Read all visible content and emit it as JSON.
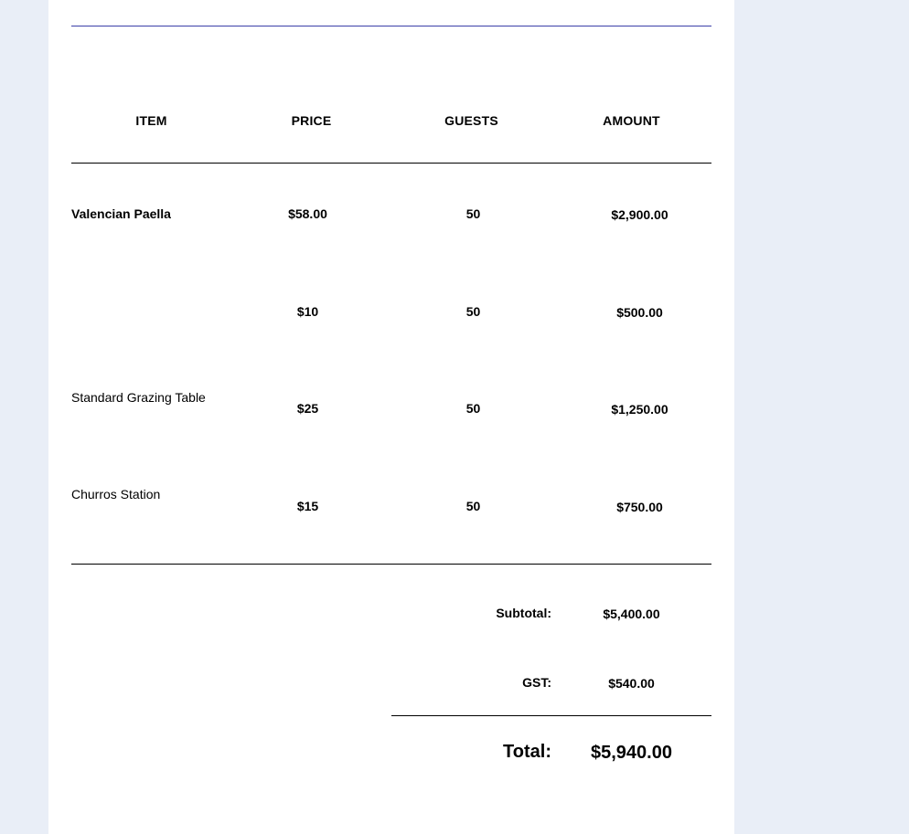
{
  "table": {
    "headers": {
      "item": "ITEM",
      "price": "PRICE",
      "guests": "GUESTS",
      "amount": "AMOUNT"
    },
    "rows": [
      {
        "item": "Valencian Paella",
        "price": "$58.00",
        "guests": "50",
        "amount": "$2,900.00"
      },
      {
        "item": "",
        "price": "$10",
        "guests": "50",
        "amount": "$500.00"
      },
      {
        "item": "Standard Grazing Table",
        "price": "$25",
        "guests": "50",
        "amount": "$1,250.00"
      },
      {
        "item": "Churros Station",
        "price": "$15",
        "guests": "50",
        "amount": "$750.00"
      }
    ]
  },
  "summary": {
    "subtotal_label": "Subtotal:",
    "subtotal_value": "$5,400.00",
    "gst_label": "GST:",
    "gst_value": "$540.00",
    "total_label": "Total:",
    "total_value": "$5,940.00"
  },
  "colors": {
    "background": "#e9eef7",
    "page": "#ffffff",
    "top_rule": "#3b3fa8"
  }
}
